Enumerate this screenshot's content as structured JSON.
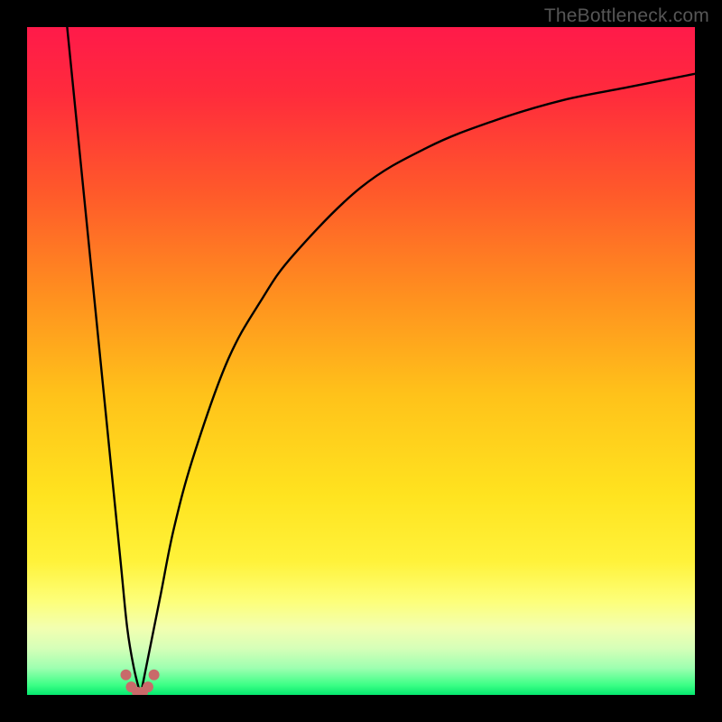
{
  "watermark": "TheBottleneck.com",
  "gradient": {
    "stops": [
      {
        "offset": 0.0,
        "color": "#ff1a4a"
      },
      {
        "offset": 0.1,
        "color": "#ff2b3c"
      },
      {
        "offset": 0.25,
        "color": "#ff5a2a"
      },
      {
        "offset": 0.4,
        "color": "#ff8f1f"
      },
      {
        "offset": 0.55,
        "color": "#ffc21a"
      },
      {
        "offset": 0.7,
        "color": "#ffe31f"
      },
      {
        "offset": 0.8,
        "color": "#fff23a"
      },
      {
        "offset": 0.86,
        "color": "#fdff7a"
      },
      {
        "offset": 0.9,
        "color": "#f2ffb0"
      },
      {
        "offset": 0.93,
        "color": "#d6ffb8"
      },
      {
        "offset": 0.96,
        "color": "#9dffb0"
      },
      {
        "offset": 0.985,
        "color": "#3dff86"
      },
      {
        "offset": 1.0,
        "color": "#05e86f"
      }
    ]
  },
  "chart_data": {
    "type": "line",
    "title": "",
    "xlabel": "",
    "ylabel": "",
    "xlim": [
      0,
      100
    ],
    "ylim": [
      0,
      100
    ],
    "minimum_x": 17,
    "left_branch": {
      "x": [
        6,
        8,
        10,
        12,
        14,
        15,
        16,
        17
      ],
      "y": [
        100,
        80,
        60,
        40,
        20,
        10,
        4,
        0
      ]
    },
    "right_branch": {
      "x": [
        17,
        18,
        20,
        22,
        25,
        30,
        35,
        40,
        50,
        60,
        70,
        80,
        90,
        100
      ],
      "y": [
        0,
        5,
        15,
        25,
        36,
        50,
        59,
        66,
        76,
        82,
        86,
        89,
        91,
        93
      ]
    },
    "markers": {
      "x": [
        14.8,
        15.6,
        16.5,
        17.3,
        18.1,
        19.0
      ],
      "y": [
        3.0,
        1.2,
        0.4,
        0.4,
        1.2,
        3.0
      ],
      "color": "#c96a6a",
      "radius_px": 6
    }
  }
}
